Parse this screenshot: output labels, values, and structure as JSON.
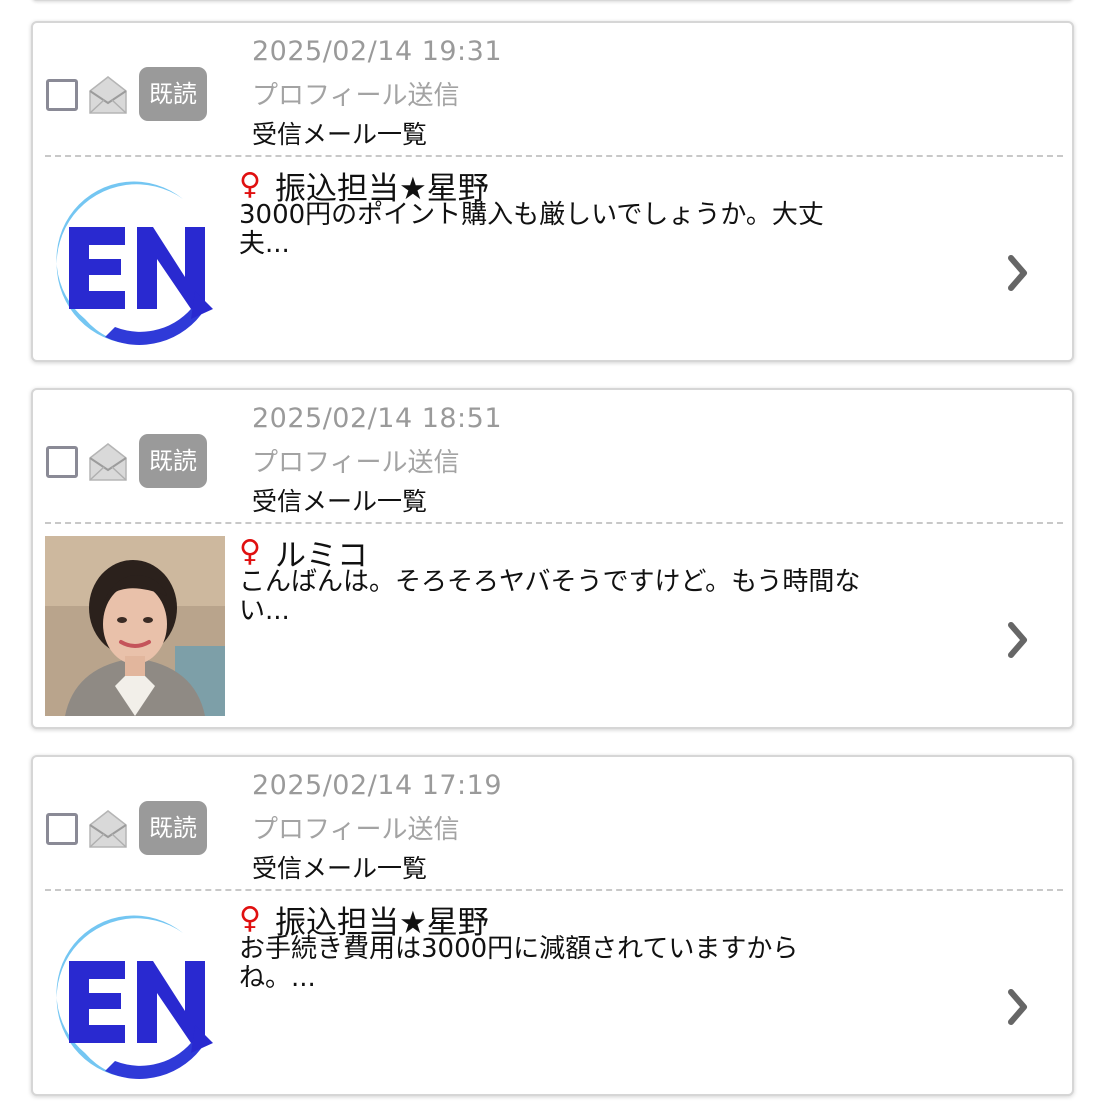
{
  "messages": [
    {
      "date": "2025/02/14 19:31",
      "kind": "プロフィール送信",
      "folder": "受信メール一覧",
      "read_badge": "既読",
      "gender_symbol": "♀",
      "sender": "振込担当★星野",
      "preview": "3000円のポイント購入も厳しいでしょうか。大丈夫...",
      "avatar": "en-logo"
    },
    {
      "date": "2025/02/14 18:51",
      "kind": "プロフィール送信",
      "folder": "受信メール一覧",
      "read_badge": "既読",
      "gender_symbol": "♀",
      "sender": "ルミコ",
      "preview": "こんばんは。そろそろヤバそうですけど。もう時間ない...",
      "avatar": "photo-woman"
    },
    {
      "date": "2025/02/14 17:19",
      "kind": "プロフィール送信",
      "folder": "受信メール一覧",
      "read_badge": "既読",
      "gender_symbol": "♀",
      "sender": "振込担当★星野",
      "preview": "お手続き費用は3000円に減額されていますからね。...",
      "avatar": "en-logo"
    }
  ],
  "colors": {
    "read_badge": "#9a9a9a",
    "female_symbol": "#e01010",
    "logo_blue": "#2b2bd6",
    "logo_light_blue": "#6fc3f0"
  }
}
